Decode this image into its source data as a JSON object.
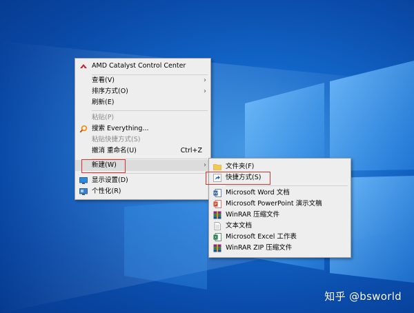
{
  "main_menu": {
    "items": [
      {
        "label": "AMD Catalyst Control Center"
      },
      {
        "label": "查看(V)"
      },
      {
        "label": "排序方式(O)"
      },
      {
        "label": "刷新(E)"
      },
      {
        "label": "粘贴(P)"
      },
      {
        "label": "搜索 Everything..."
      },
      {
        "label": "粘贴快捷方式(S)"
      },
      {
        "label": "撤消 重命名(U)",
        "shortcut": "Ctrl+Z"
      },
      {
        "label": "新建(W)"
      },
      {
        "label": "显示设置(D)"
      },
      {
        "label": "个性化(R)"
      }
    ]
  },
  "sub_menu": {
    "items": [
      {
        "label": "文件夹(F)"
      },
      {
        "label": "快捷方式(S)"
      },
      {
        "label": "Microsoft Word 文档"
      },
      {
        "label": "Microsoft PowerPoint 演示文稿"
      },
      {
        "label": "WinRAR 压缩文件"
      },
      {
        "label": "文本文档"
      },
      {
        "label": "Microsoft Excel 工作表"
      },
      {
        "label": "WinRAR ZIP 压缩文件"
      }
    ]
  },
  "watermark": "知乎 @bsworld",
  "colors": {
    "highlight": "#e0302c",
    "menu_bg": "#eeeeee",
    "desktop": "#1267c9"
  }
}
